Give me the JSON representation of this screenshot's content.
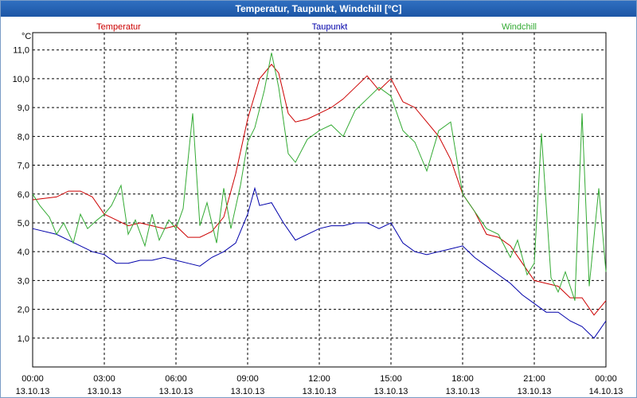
{
  "window": {
    "title": "Temperatur, Taupunkt, Windchill [°C]"
  },
  "chart_data": {
    "type": "line",
    "title": "Temperatur, Taupunkt, Windchill [°C]",
    "ylabel": "°C",
    "ylim": [
      0.0,
      11.6
    ],
    "yticks": [
      "1,0",
      "2,0",
      "3,0",
      "4,0",
      "5,0",
      "6,0",
      "7,0",
      "8,0",
      "9,0",
      "10,0",
      "11,0"
    ],
    "ytick_values": [
      1,
      2,
      3,
      4,
      5,
      6,
      7,
      8,
      9,
      10,
      11
    ],
    "xlim_hours": [
      0,
      24
    ],
    "x_unit": "hours since 13.10.13 00:00",
    "xticks": [
      {
        "time": "00:00",
        "date": "13.10.13"
      },
      {
        "time": "03:00",
        "date": "13.10.13"
      },
      {
        "time": "06:00",
        "date": "13.10.13"
      },
      {
        "time": "09:00",
        "date": "13.10.13"
      },
      {
        "time": "12:00",
        "date": "13.10.13"
      },
      {
        "time": "15:00",
        "date": "13.10.13"
      },
      {
        "time": "18:00",
        "date": "13.10.13"
      },
      {
        "time": "21:00",
        "date": "13.10.13"
      },
      {
        "time": "00:00",
        "date": "14.10.13"
      }
    ],
    "grid": true,
    "legend_position": "top",
    "series": [
      {
        "name": "Temperatur",
        "color": "#cc0000",
        "x": [
          0,
          1,
          1.5,
          2,
          2.5,
          3,
          3.5,
          4,
          4.5,
          5,
          5.5,
          6,
          6.5,
          7,
          7.5,
          8,
          8.5,
          9,
          9.5,
          10,
          10.3,
          10.7,
          11,
          11.5,
          12,
          12.5,
          13,
          13.5,
          14,
          14.5,
          15,
          15.5,
          16,
          16.5,
          17,
          17.5,
          18,
          18.5,
          19,
          19.5,
          20,
          20.5,
          21,
          21.5,
          22,
          22.5,
          23,
          23.5,
          24
        ],
        "values": [
          5.8,
          5.9,
          6.1,
          6.1,
          5.9,
          5.3,
          5.1,
          4.9,
          5.0,
          4.9,
          4.8,
          4.9,
          4.5,
          4.5,
          4.7,
          5.2,
          6.7,
          8.6,
          10.0,
          10.5,
          10.2,
          8.8,
          8.5,
          8.6,
          8.8,
          9.0,
          9.3,
          9.7,
          10.1,
          9.6,
          10.0,
          9.2,
          9.0,
          8.5,
          8.0,
          7.2,
          6.0,
          5.4,
          4.6,
          4.5,
          4.2,
          3.6,
          3.0,
          2.9,
          2.8,
          2.4,
          2.4,
          1.8,
          2.3
        ]
      },
      {
        "name": "Taupunkt",
        "color": "#0000aa",
        "x": [
          0,
          1,
          1.5,
          2,
          2.5,
          3,
          3.5,
          4,
          4.5,
          5,
          5.5,
          6,
          6.5,
          7,
          7.5,
          8,
          8.5,
          9,
          9.3,
          9.5,
          10,
          10.5,
          11,
          11.5,
          12,
          12.5,
          13,
          13.5,
          14,
          14.5,
          15,
          15.5,
          16,
          16.5,
          17,
          17.5,
          18,
          18.5,
          19,
          19.5,
          20,
          20.5,
          21,
          21.5,
          22,
          22.5,
          23,
          23.5,
          24
        ],
        "values": [
          4.8,
          4.6,
          4.4,
          4.2,
          4.0,
          3.9,
          3.6,
          3.6,
          3.7,
          3.7,
          3.8,
          3.7,
          3.6,
          3.5,
          3.8,
          4.0,
          4.3,
          5.3,
          6.2,
          5.6,
          5.7,
          5.0,
          4.4,
          4.6,
          4.8,
          4.9,
          4.9,
          5.0,
          5.0,
          4.8,
          5.0,
          4.3,
          4.0,
          3.9,
          4.0,
          4.1,
          4.2,
          3.8,
          3.5,
          3.2,
          2.9,
          2.5,
          2.2,
          1.9,
          1.9,
          1.6,
          1.4,
          1.0,
          1.6
        ]
      },
      {
        "name": "Windchill",
        "color": "#33aa33",
        "x": [
          0,
          0.3,
          0.7,
          1,
          1.3,
          1.7,
          2,
          2.3,
          2.7,
          3,
          3.3,
          3.7,
          4,
          4.3,
          4.7,
          5,
          5.3,
          5.7,
          6,
          6.3,
          6.7,
          7,
          7.3,
          7.7,
          8,
          8.3,
          8.7,
          9,
          9.3,
          9.7,
          10,
          10.3,
          10.7,
          11,
          11.5,
          12,
          12.5,
          13,
          13.5,
          14,
          14.5,
          15,
          15.5,
          16,
          16.5,
          17,
          17.5,
          18,
          18.5,
          19,
          19.5,
          20,
          20.3,
          20.7,
          21,
          21.3,
          21.7,
          22,
          22.3,
          22.7,
          23,
          23.3,
          23.7,
          24
        ],
        "values": [
          6.0,
          5.6,
          5.2,
          4.6,
          5.0,
          4.3,
          5.3,
          4.8,
          5.1,
          5.3,
          5.6,
          6.3,
          4.6,
          5.1,
          4.2,
          5.3,
          4.4,
          5.1,
          4.8,
          5.5,
          8.8,
          4.9,
          5.7,
          4.3,
          6.2,
          4.8,
          6.3,
          7.8,
          8.3,
          9.6,
          10.9,
          9.7,
          7.4,
          7.1,
          7.9,
          8.2,
          8.4,
          8.0,
          8.9,
          9.3,
          9.7,
          9.4,
          8.2,
          7.8,
          6.8,
          8.2,
          8.5,
          6.0,
          5.4,
          4.8,
          4.6,
          3.8,
          4.4,
          3.2,
          3.6,
          8.1,
          3.1,
          2.6,
          3.3,
          2.3,
          8.8,
          2.8,
          6.2,
          3.3
        ]
      }
    ]
  }
}
